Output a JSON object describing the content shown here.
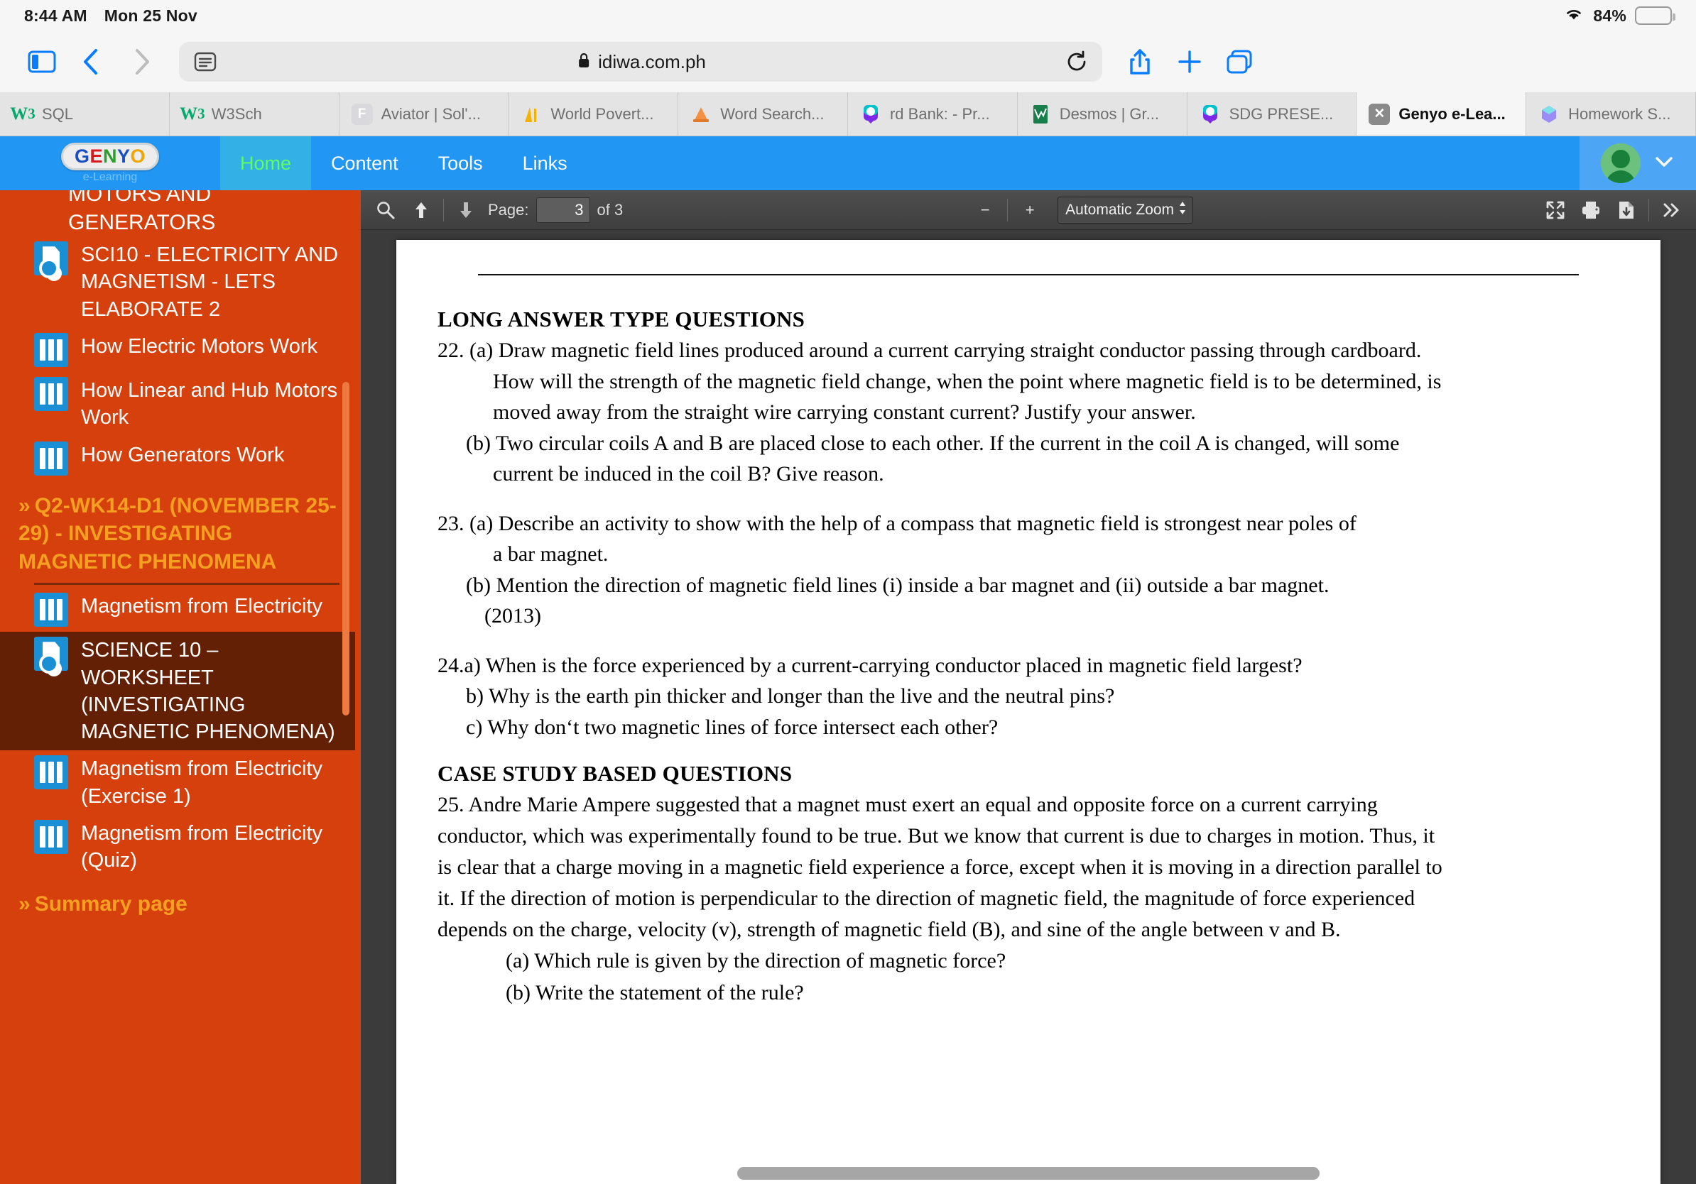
{
  "status_bar": {
    "time": "8:44 AM",
    "date": "Mon 25 Nov",
    "battery_percent": "84%",
    "battery_color": "#f5c518",
    "wifi_icon": "wifi-icon"
  },
  "browser": {
    "sidebar_toggle_icon": "sidebar-icon",
    "back_icon": "chevron-left-icon",
    "forward_icon": "chevron-right-icon",
    "reader_icon": "reader-view-icon",
    "lock_icon": "lock-icon",
    "url": "idiwa.com.ph",
    "reload_icon": "reload-icon",
    "share_icon": "share-icon",
    "new_tab_icon": "plus-icon",
    "tabs_overview_icon": "tabs-overview-icon",
    "tabs": [
      {
        "label": "SQL",
        "icon": "w3schools-icon",
        "active": false
      },
      {
        "label": "W3Sch",
        "icon": "w3schools-icon",
        "active": false
      },
      {
        "label": "Aviator | Sol'...",
        "icon": "f-letter-icon",
        "active": false
      },
      {
        "label": "World Povert...",
        "icon": "chart-icon",
        "active": false
      },
      {
        "label": "Word Search...",
        "icon": "orange-cone-icon",
        "active": false
      },
      {
        "label": "rd Bank: - Pr...",
        "icon": "canva-icon",
        "active": false
      },
      {
        "label": "Desmos | Gr...",
        "icon": "desmos-icon",
        "active": false
      },
      {
        "label": "SDG PRESE...",
        "icon": "canva-icon",
        "active": false
      },
      {
        "label": "Genyo e-Lea...",
        "icon": "close-tab-icon",
        "active": true
      },
      {
        "label": "Homework S...",
        "icon": "hexagon-icon",
        "active": false
      }
    ]
  },
  "site_header": {
    "logo_letters": [
      "G",
      "E",
      "N",
      "Y",
      "O"
    ],
    "logo_subtitle": "e-Learning",
    "nav": [
      {
        "label": "Home",
        "active": true
      },
      {
        "label": "Content",
        "active": false
      },
      {
        "label": "Tools",
        "active": false
      },
      {
        "label": "Links",
        "active": false
      }
    ],
    "avatar_name": "avatar",
    "account_chevron": "chevron-down-icon",
    "brand_color": "#2196f3",
    "active_nav_color": "#5dfc69"
  },
  "sidebar": {
    "background_color": "#d6400d",
    "selected_color": "#632005",
    "section_color": "#f5a020",
    "clipped_top_text": "MOTORS AND GENERATORS",
    "items_top": [
      {
        "label": "SCI10 - ELECTRICITY AND MAGNETISM - LETS ELABORATE 2",
        "icon": "worksheet-doc-icon",
        "selected": false
      },
      {
        "label": "How Electric Motors Work",
        "icon": "slides-icon",
        "selected": false
      },
      {
        "label": "How Linear and Hub Motors Work",
        "icon": "slides-icon",
        "selected": false
      },
      {
        "label": "How Generators Work",
        "icon": "slides-icon",
        "selected": false
      }
    ],
    "section_title": "Q2-WK14-D1 (NOVEMBER 25-29) - INVESTIGATING MAGNETIC PHENOMENA",
    "items_section": [
      {
        "label": "Magnetism from Electricity",
        "icon": "slides-icon",
        "selected": false
      },
      {
        "label": "SCIENCE 10 – WORKSHEET (INVESTIGATING MAGNETIC PHENOMENA)",
        "icon": "worksheet-doc-icon",
        "selected": true
      },
      {
        "label": "Magnetism from Electricity (Exercise 1)",
        "icon": "slides-icon",
        "selected": false
      },
      {
        "label": "Magnetism from Electricity (Quiz)",
        "icon": "slides-icon",
        "selected": false
      }
    ],
    "footer_section_title": "Summary page",
    "chevron_glyph": "»"
  },
  "pdf_toolbar": {
    "search_icon": "search-icon",
    "previous_page_icon": "arrow-up-icon",
    "next_page_icon": "arrow-down-icon",
    "page_label": "Page:",
    "page_value": "3",
    "page_total": "of 3",
    "zoom_out_label": "−",
    "zoom_in_label": "+",
    "zoom_select_value": "Automatic Zoom",
    "zoom_select_arrows": "⬍",
    "presentation_icon": "fullscreen-icon",
    "print_icon": "print-icon",
    "download_icon": "download-icon",
    "more_tools_icon": "double-chevron-right-icon"
  },
  "document": {
    "heading_long": "LONG ANSWER TYPE QUESTIONS",
    "q22": {
      "a1": "22. (a) Draw magnetic field lines produced around a current carrying straight conductor passing through cardboard.",
      "a2": "How will the strength of the magnetic field change, when the point where magnetic field is to be determined, is",
      "a3": "moved away from the straight wire carrying constant current? Justify your answer.",
      "b1": "(b) Two circular coils A and B are placed close to each other. If the current in the coil A is changed, will some",
      "b2": "current be induced in the coil B? Give reason."
    },
    "q23": {
      "a1": "23. (a) Describe an activity to show with the help of a compass that magnetic field is strongest near poles of",
      "a2": "a bar magnet.",
      "b1": "(b) Mention the direction of magnetic field lines (i) inside a bar magnet and (ii) outside a bar magnet.",
      "b2": "(2013)"
    },
    "q24": {
      "a": "24.a) When is the force experienced by a current-carrying conductor placed in magnetic field largest?",
      "b": "b) Why is the earth pin thicker and longer than the live and the neutral pins?",
      "c": "c) Why don‘t two magnetic lines of force intersect each other?"
    },
    "heading_case": "CASE STUDY BASED QUESTIONS",
    "q25": {
      "l1": "25. Andre Marie Ampere suggested that a magnet must exert an equal and opposite force on a current carrying",
      "l2": "conductor, which was experimentally found to be true. But we know that current is due to charges in motion. Thus, it",
      "l3": "is clear that a charge moving in a magnetic field experience a force, except when it is moving in a direction parallel to",
      "l4": "it. If the direction of motion is perpendicular to the direction of magnetic field, the magnitude of force experienced",
      "l5": "depends on the charge, velocity (v), strength of magnetic field (B), and sine of the angle between v and B.",
      "a": "(a) Which rule is given by the direction of magnetic force?",
      "b": "(b) Write the statement of the rule?"
    }
  }
}
